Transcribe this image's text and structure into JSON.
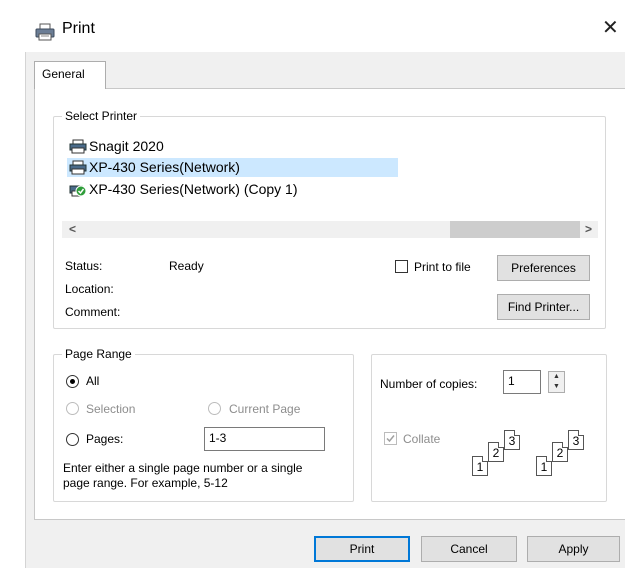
{
  "window": {
    "title": "Print",
    "close_glyph": "✕"
  },
  "tabs": [
    {
      "label": "General"
    }
  ],
  "select_printer": {
    "legend": "Select Printer",
    "printers": [
      {
        "name": "Snagit 2020",
        "icon": "printer-icon",
        "selected": false
      },
      {
        "name": "XP-430 Series(Network)",
        "icon": "printer-icon",
        "selected": true
      },
      {
        "name": "XP-430 Series(Network) (Copy 1)",
        "icon": "default-printer-icon",
        "selected": false
      }
    ],
    "scroll_left": "<",
    "scroll_right": ">",
    "status_label": "Status:",
    "status_value": "Ready",
    "location_label": "Location:",
    "comment_label": "Comment:",
    "print_to_file_label": "Print to file",
    "print_to_file_checked": false,
    "preferences_button": "Preferences",
    "find_printer_button": "Find Printer..."
  },
  "page_range": {
    "legend": "Page Range",
    "all_label": "All",
    "selection_label": "Selection",
    "current_page_label": "Current Page",
    "pages_label": "Pages:",
    "pages_value": "1-3",
    "selected_option": "All",
    "help_text_line1": "Enter either a single page number or a single",
    "help_text_line2": "page range.  For example, 5-12"
  },
  "copies": {
    "number_label": "Number of copies:",
    "number_value": "1",
    "collate_label": "Collate",
    "collate_checked": true,
    "collate_pages": [
      "1",
      "2",
      "3"
    ]
  },
  "footer": {
    "print_button": "Print",
    "cancel_button": "Cancel",
    "apply_button": "Apply"
  },
  "colors": {
    "selection": "#cce8ff",
    "default_button_border": "#0078d7",
    "dialog_bg": "#f0f0f0"
  }
}
